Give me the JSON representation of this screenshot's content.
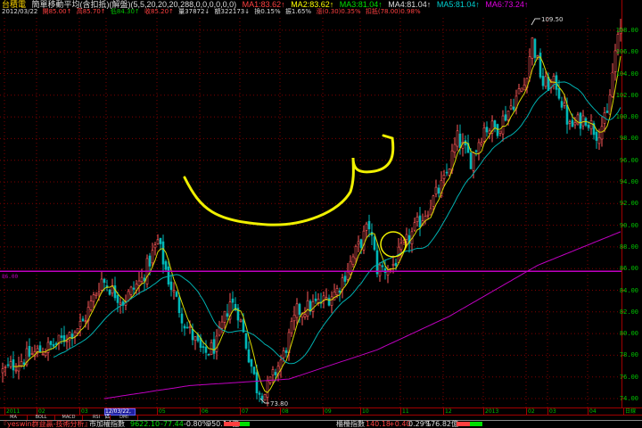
{
  "header": {
    "stock": "台積電",
    "indicator": "簡單移動平均(含扣抵)(解盤)(5,5,20,20,20,288,0,0,0,0,0,0)",
    "ma": [
      "MA1:83.62↑",
      "MA2:83.62↑",
      "MA3:81.04↑",
      "MA4:81.04↑",
      "MA5:81.04↑",
      "MA6:73.24↑"
    ],
    "date": "2012/03/22",
    "open": "開85.00↑",
    "high": "高85.70↑",
    "low": "低84.30↑",
    "close": "收85.20↑",
    "volume": "量37872↓",
    "amount": "額322173↓",
    "turnover": "換0.15%",
    "amplitude": "振1.65%",
    "change": "漲(0.30)0.35%",
    "deduction": "扣抵(78.00)0.98%"
  },
  "chart_data": {
    "type": "candlestick",
    "title": "台積電 簡單移動平均",
    "ylim": [
      73,
      110
    ],
    "yticks": [
      "74.00",
      "76.00",
      "78.00",
      "80.00",
      "82.00",
      "84.00",
      "86.00",
      "88.00",
      "90.00",
      "92.00",
      "94.00",
      "96.00",
      "98.00",
      "100.00",
      "102.00",
      "104.00",
      "106.00",
      "108.00"
    ],
    "xticks": [
      "2011",
      "02",
      "03",
      "04",
      "05",
      "06",
      "07",
      "08",
      "09",
      "10",
      "11",
      "12",
      "2013",
      "02",
      "03",
      "04"
    ],
    "x_unit_label": "日線",
    "selected_date": "12/03/22,四",
    "reference_line": {
      "value": 86.0,
      "label": "86.00"
    },
    "annotations": {
      "max": "109.50",
      "min": "73.80"
    },
    "price_path": [
      [
        0,
        76.5
      ],
      [
        10,
        78
      ],
      [
        20,
        79
      ],
      [
        30,
        81
      ],
      [
        37,
        85
      ],
      [
        45,
        83
      ],
      [
        52,
        85
      ],
      [
        58,
        88.5
      ],
      [
        62,
        85
      ],
      [
        68,
        81
      ],
      [
        75,
        78
      ],
      [
        80,
        79
      ],
      [
        85,
        83
      ],
      [
        88,
        82
      ],
      [
        95,
        75
      ],
      [
        98,
        74.5
      ],
      [
        105,
        78
      ],
      [
        110,
        82
      ],
      [
        120,
        83
      ],
      [
        125,
        84
      ],
      [
        133,
        88
      ],
      [
        137,
        90
      ],
      [
        140,
        86
      ],
      [
        145,
        86
      ],
      [
        150,
        88
      ],
      [
        155,
        90
      ],
      [
        160,
        92
      ],
      [
        165,
        94
      ],
      [
        170,
        98
      ],
      [
        175,
        96
      ],
      [
        180,
        99
      ],
      [
        185,
        99
      ],
      [
        190,
        101
      ],
      [
        195,
        103
      ],
      [
        198,
        107
      ],
      [
        202,
        103
      ],
      [
        207,
        103
      ],
      [
        212,
        99
      ],
      [
        218,
        100
      ],
      [
        222,
        98.5
      ],
      [
        226,
        100
      ],
      [
        229,
        106
      ],
      [
        231,
        108
      ]
    ],
    "ma288_path": [
      [
        38,
        74.0
      ],
      [
        70,
        75.2
      ],
      [
        107,
        75.8
      ],
      [
        140,
        78.5
      ],
      [
        167,
        81.6
      ],
      [
        200,
        86.3
      ],
      [
        231,
        89.4
      ]
    ],
    "colors": {
      "up": "#ff5a5a",
      "down": "#00b8b8",
      "ma5": "#d8d800",
      "ma20": "#00b0b0",
      "ma288": "#c000c0",
      "grid": "#800000"
    }
  },
  "tabs": [
    "MA",
    "BOLL",
    "MACD",
    "RSI",
    "DMI"
  ],
  "status": {
    "brand": "『yeswin群益贏-技術分析』",
    "idx1_name": "市加權指數",
    "idx1_value": "9622.10",
    "idx1_change": "-77.44",
    "idx1_pct": "-0.80%",
    "idx1_amount": "950.14億",
    "idx2_name": "櫃檯指數",
    "idx2_value": "140.18",
    "idx2_change": "+0.40",
    "idx2_pct": "0.29%",
    "idx2_amount": "176.82億"
  }
}
